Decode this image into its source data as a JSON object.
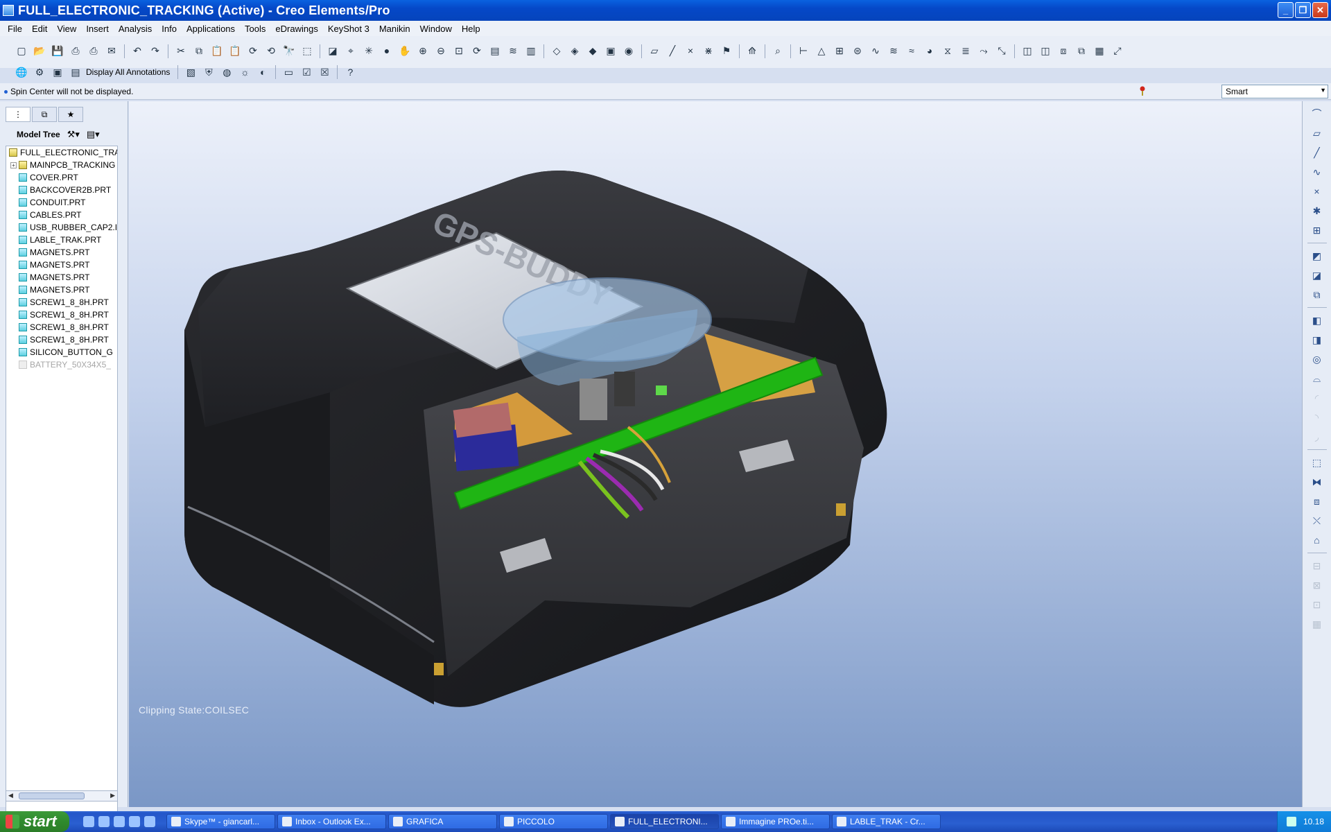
{
  "window": {
    "title": "FULL_ELECTRONIC_TRACKING (Active) - Creo Elements/Pro"
  },
  "menu": [
    "File",
    "Edit",
    "View",
    "Insert",
    "Analysis",
    "Info",
    "Applications",
    "Tools",
    "eDrawings",
    "KeyShot 3",
    "Manikin",
    "Window",
    "Help"
  ],
  "toolbar": {
    "display_annotations_label": "Display All Annotations"
  },
  "message": {
    "text": "Spin Center will not be displayed."
  },
  "filter": {
    "selected": "Smart"
  },
  "model_tree": {
    "label": "Model Tree",
    "items": [
      {
        "label": "FULL_ELECTRONIC_TRA",
        "type": "assembly",
        "level": 0
      },
      {
        "label": "MAINPCB_TRACKING",
        "type": "assembly",
        "level": 1,
        "expandable": true
      },
      {
        "label": "COVER.PRT",
        "type": "part",
        "level": 1
      },
      {
        "label": "BACKCOVER2B.PRT",
        "type": "part",
        "level": 1
      },
      {
        "label": "CONDUIT.PRT",
        "type": "part",
        "level": 1
      },
      {
        "label": "CABLES.PRT",
        "type": "part",
        "level": 1
      },
      {
        "label": "USB_RUBBER_CAP2.I",
        "type": "part",
        "level": 1
      },
      {
        "label": "LABLE_TRAK.PRT",
        "type": "part",
        "level": 1
      },
      {
        "label": "MAGNETS.PRT",
        "type": "part",
        "level": 1
      },
      {
        "label": "MAGNETS.PRT",
        "type": "part",
        "level": 1
      },
      {
        "label": "MAGNETS.PRT",
        "type": "part",
        "level": 1
      },
      {
        "label": "MAGNETS.PRT",
        "type": "part",
        "level": 1
      },
      {
        "label": "SCREW1_8_8H.PRT",
        "type": "part",
        "level": 1
      },
      {
        "label": "SCREW1_8_8H.PRT",
        "type": "part",
        "level": 1
      },
      {
        "label": "SCREW1_8_8H.PRT",
        "type": "part",
        "level": 1
      },
      {
        "label": "SCREW1_8_8H.PRT",
        "type": "part",
        "level": 1
      },
      {
        "label": "SILICON_BUTTON_G",
        "type": "part",
        "level": 1
      },
      {
        "label": "BATTERY_50X34X5_",
        "type": "part",
        "level": 1,
        "suppressed": true
      }
    ]
  },
  "viewport": {
    "clipping_state": "Clipping State:COILSEC",
    "label_text": "GPS-BUDDY"
  },
  "taskbar": {
    "start_label": "start",
    "tasks": [
      {
        "label": "Skype™ - giancarl..."
      },
      {
        "label": "Inbox - Outlook Ex..."
      },
      {
        "label": "GRAFICA"
      },
      {
        "label": "PICCOLO"
      },
      {
        "label": "FULL_ELECTRONI...",
        "active": true
      },
      {
        "label": "Immagine PROe.ti..."
      },
      {
        "label": "LABLE_TRAK - Cr..."
      }
    ],
    "clock": "10.18"
  }
}
